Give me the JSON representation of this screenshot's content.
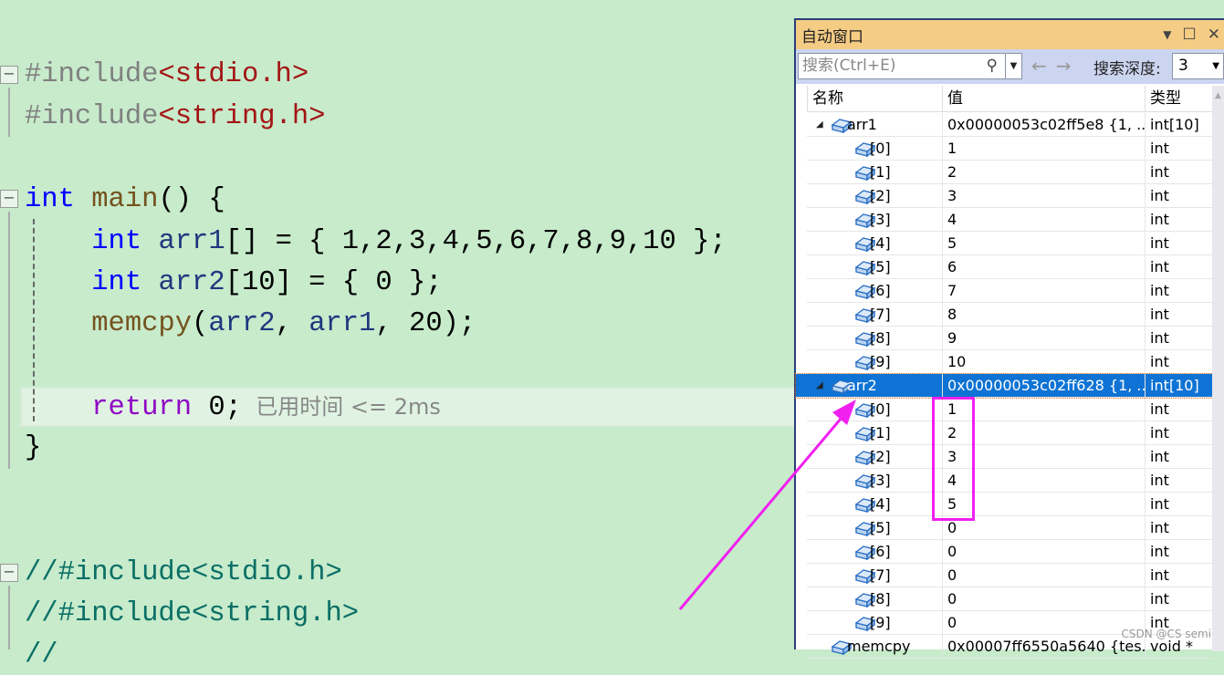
{
  "editor": {
    "lines": [
      {
        "parts": [
          [
            "dir",
            "#include"
          ],
          [
            "str",
            "<stdio.h>"
          ]
        ]
      },
      {
        "parts": [
          [
            "dir",
            "#include"
          ],
          [
            "str",
            "<string.h>"
          ]
        ]
      },
      {
        "parts": [
          [
            "kw",
            "int"
          ],
          [
            "num",
            " "
          ],
          [
            "fn",
            "main"
          ],
          [
            "num",
            "() {"
          ]
        ]
      },
      {
        "parts": [
          [
            "num",
            "    "
          ],
          [
            "kw",
            "int"
          ],
          [
            "num",
            " "
          ],
          [
            "var",
            "arr1"
          ],
          [
            "num",
            "[] = { 1,2,3,4,5,6,7,8,9,10 };"
          ]
        ]
      },
      {
        "parts": [
          [
            "num",
            "    "
          ],
          [
            "kw",
            "int"
          ],
          [
            "num",
            " "
          ],
          [
            "var",
            "arr2"
          ],
          [
            "num",
            "[10] = { 0 };"
          ]
        ]
      },
      {
        "parts": [
          [
            "num",
            "    "
          ],
          [
            "fn",
            "memcpy"
          ],
          [
            "num",
            "("
          ],
          [
            "var",
            "arr2"
          ],
          [
            "num",
            ", "
          ],
          [
            "var",
            "arr1"
          ],
          [
            "num",
            ", 20);"
          ]
        ]
      },
      {
        "parts": [
          [
            "num",
            "    "
          ],
          [
            "ret",
            "return"
          ],
          [
            "num",
            " 0;"
          ]
        ]
      },
      {
        "parts": [
          [
            "num",
            "}"
          ]
        ]
      },
      {
        "parts": [
          [
            "cm",
            "//#include<stdio.h>"
          ]
        ]
      },
      {
        "parts": [
          [
            "cm",
            "//#include<string.h>"
          ]
        ]
      },
      {
        "parts": [
          [
            "cm",
            "//"
          ]
        ]
      }
    ],
    "perf_hint": "已用时间 <= 2ms"
  },
  "autos": {
    "title": "自动窗口",
    "search_placeholder": "搜索(Ctrl+E)",
    "depth_label": "搜索深度:",
    "depth_value": "3",
    "columns": [
      "名称",
      "值",
      "类型"
    ],
    "rows": [
      {
        "name": "arr1",
        "value": "0x00000053c02ff5e8 {1, ...",
        "type": "int[10]",
        "level": 0,
        "expanded": true
      },
      {
        "name": "[0]",
        "value": "1",
        "type": "int",
        "level": 1
      },
      {
        "name": "[1]",
        "value": "2",
        "type": "int",
        "level": 1
      },
      {
        "name": "[2]",
        "value": "3",
        "type": "int",
        "level": 1
      },
      {
        "name": "[3]",
        "value": "4",
        "type": "int",
        "level": 1
      },
      {
        "name": "[4]",
        "value": "5",
        "type": "int",
        "level": 1
      },
      {
        "name": "[5]",
        "value": "6",
        "type": "int",
        "level": 1
      },
      {
        "name": "[6]",
        "value": "7",
        "type": "int",
        "level": 1
      },
      {
        "name": "[7]",
        "value": "8",
        "type": "int",
        "level": 1
      },
      {
        "name": "[8]",
        "value": "9",
        "type": "int",
        "level": 1
      },
      {
        "name": "[9]",
        "value": "10",
        "type": "int",
        "level": 1
      },
      {
        "name": "arr2",
        "value": "0x00000053c02ff628 {1, ...",
        "type": "int[10]",
        "level": 0,
        "expanded": true,
        "selected": true
      },
      {
        "name": "[0]",
        "value": "1",
        "type": "int",
        "level": 1
      },
      {
        "name": "[1]",
        "value": "2",
        "type": "int",
        "level": 1
      },
      {
        "name": "[2]",
        "value": "3",
        "type": "int",
        "level": 1
      },
      {
        "name": "[3]",
        "value": "4",
        "type": "int",
        "level": 1
      },
      {
        "name": "[4]",
        "value": "5",
        "type": "int",
        "level": 1
      },
      {
        "name": "[5]",
        "value": "0",
        "type": "int",
        "level": 1
      },
      {
        "name": "[6]",
        "value": "0",
        "type": "int",
        "level": 1
      },
      {
        "name": "[7]",
        "value": "0",
        "type": "int",
        "level": 1
      },
      {
        "name": "[8]",
        "value": "0",
        "type": "int",
        "level": 1
      },
      {
        "name": "[9]",
        "value": "0",
        "type": "int",
        "level": 1
      },
      {
        "name": "memcpy",
        "value": "0x00007ff6550a5640 {tes...",
        "type": "void *",
        "level": 0
      }
    ]
  },
  "annotation_color": "#f020f0",
  "watermark": "CSDN @CS semi"
}
